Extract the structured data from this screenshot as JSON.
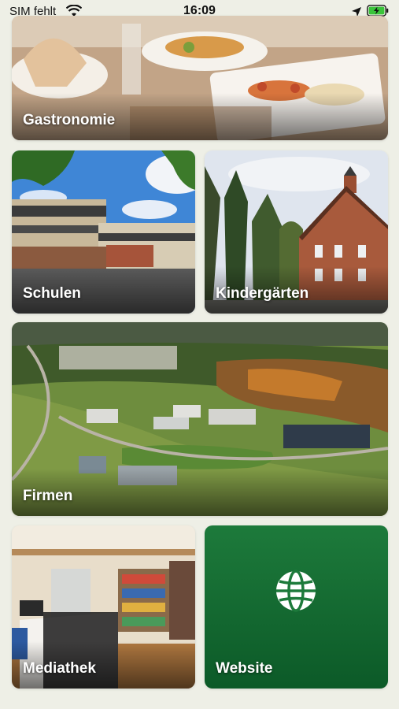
{
  "status_bar": {
    "carrier": "SIM fehlt",
    "time": "16:09",
    "icons": [
      "wifi-icon",
      "location-arrow-icon",
      "battery-charging-icon"
    ]
  },
  "tiles": [
    {
      "label": "Gastronomie",
      "image": "restaurant table setting"
    },
    {
      "label": "Schulen",
      "image": "school building"
    },
    {
      "label": "Kindergärten",
      "image": "brick kindergarten house"
    },
    {
      "label": "Firmen",
      "image": "aerial view business park"
    },
    {
      "label": "Mediathek",
      "image": "library interior"
    },
    {
      "label": "Website",
      "icon": "globe-icon"
    }
  ],
  "colors": {
    "background": "#eeefe6",
    "website_tile": "#1d7a3b",
    "label_text": "#ffffff"
  }
}
